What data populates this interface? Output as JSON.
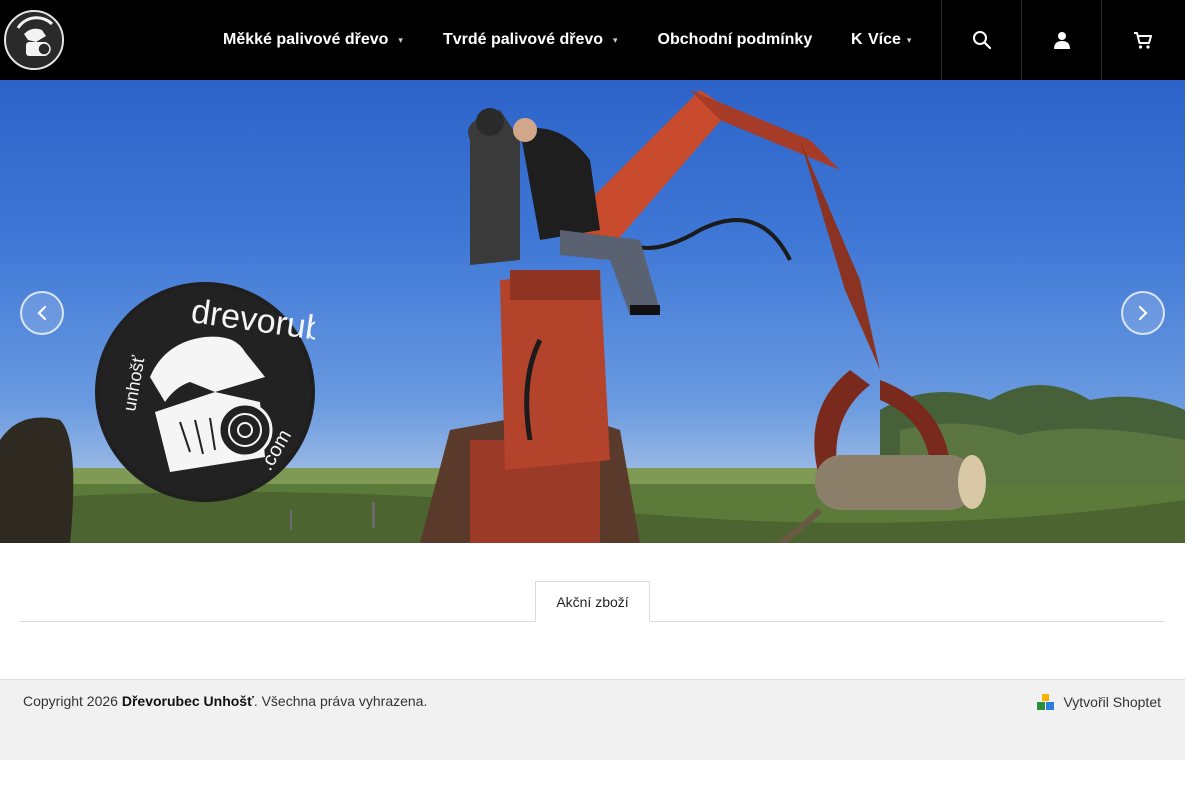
{
  "header": {
    "logo_alt": "dřevorubec unhošť logo",
    "nav": [
      {
        "label": "Měkké palivové dřevo",
        "caret": "▾"
      },
      {
        "label": "Tvrdé palivové dřevo",
        "caret": "▾"
      },
      {
        "label": "Obchodní podmínky"
      }
    ],
    "more_partial": "K",
    "more_label": "Více",
    "more_caret": "▾",
    "icons": [
      "search-icon",
      "user-icon",
      "cart-icon"
    ]
  },
  "hero": {
    "logo_text_main": "drevorubec",
    "logo_text_side": "unhošť",
    "logo_text_domain": ".com",
    "prev_icon": "chevron-left-icon",
    "next_icon": "chevron-right-icon"
  },
  "tabs": [
    {
      "label": "Akční zboží",
      "active": true
    }
  ],
  "footer": {
    "copyright_prefix": "Copyright 2026 ",
    "company": "Dřevorubec Unhošť",
    "copyright_suffix": ". Všechna práva vyhrazena.",
    "shoptet_label": "Vytvořil Shoptet"
  },
  "colors": {
    "header_bg": "#000000",
    "footer_bg": "#f1f1f1",
    "crane_red": "#b8402a",
    "sky": "#3f78d6"
  }
}
